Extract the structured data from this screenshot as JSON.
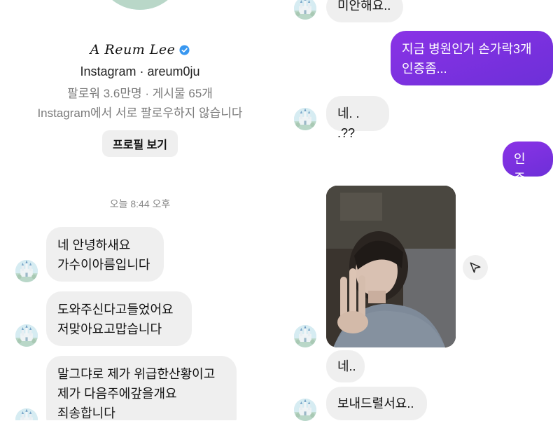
{
  "profile": {
    "signature": "A Reum Lee",
    "platform_line": "Instagram · areum0ju",
    "stats_line": "팔로워 3.6만명 · 게시물 65개",
    "follow_status": "Instagram에서 서로 팔로우하지 않습니다",
    "view_profile_label": "프로필 보기"
  },
  "timestamp": "오늘 8:44 오후",
  "left_messages": [
    {
      "text": "네 안녕하새요\n가수이아름입니다"
    },
    {
      "text": "도와주신다고들었어요\n저맞아요고맙습니다"
    },
    {
      "text": "말그댜로 제가 위급한산황이고\n제가 다음주에갚을개요\n죄송합니다"
    }
  ],
  "right_messages": [
    {
      "text": "미안해요..",
      "direction": "received"
    },
    {
      "text": "지금 병원인거 손가락3개\n인증좀...",
      "direction": "sent"
    },
    {
      "text": "네. . .??",
      "direction": "received"
    },
    {
      "text": "인증..",
      "direction": "sent"
    },
    {
      "text": "네..",
      "direction": "received"
    },
    {
      "text": "보내드렬서요..",
      "direction": "received"
    }
  ],
  "icons": {
    "verified": "verified-badge-icon",
    "share": "send-icon",
    "avatar": "castle-avatar"
  },
  "colors": {
    "sent_bubble": "#7f2fe0",
    "received_bubble": "#efefef",
    "verified": "#3897f0"
  }
}
